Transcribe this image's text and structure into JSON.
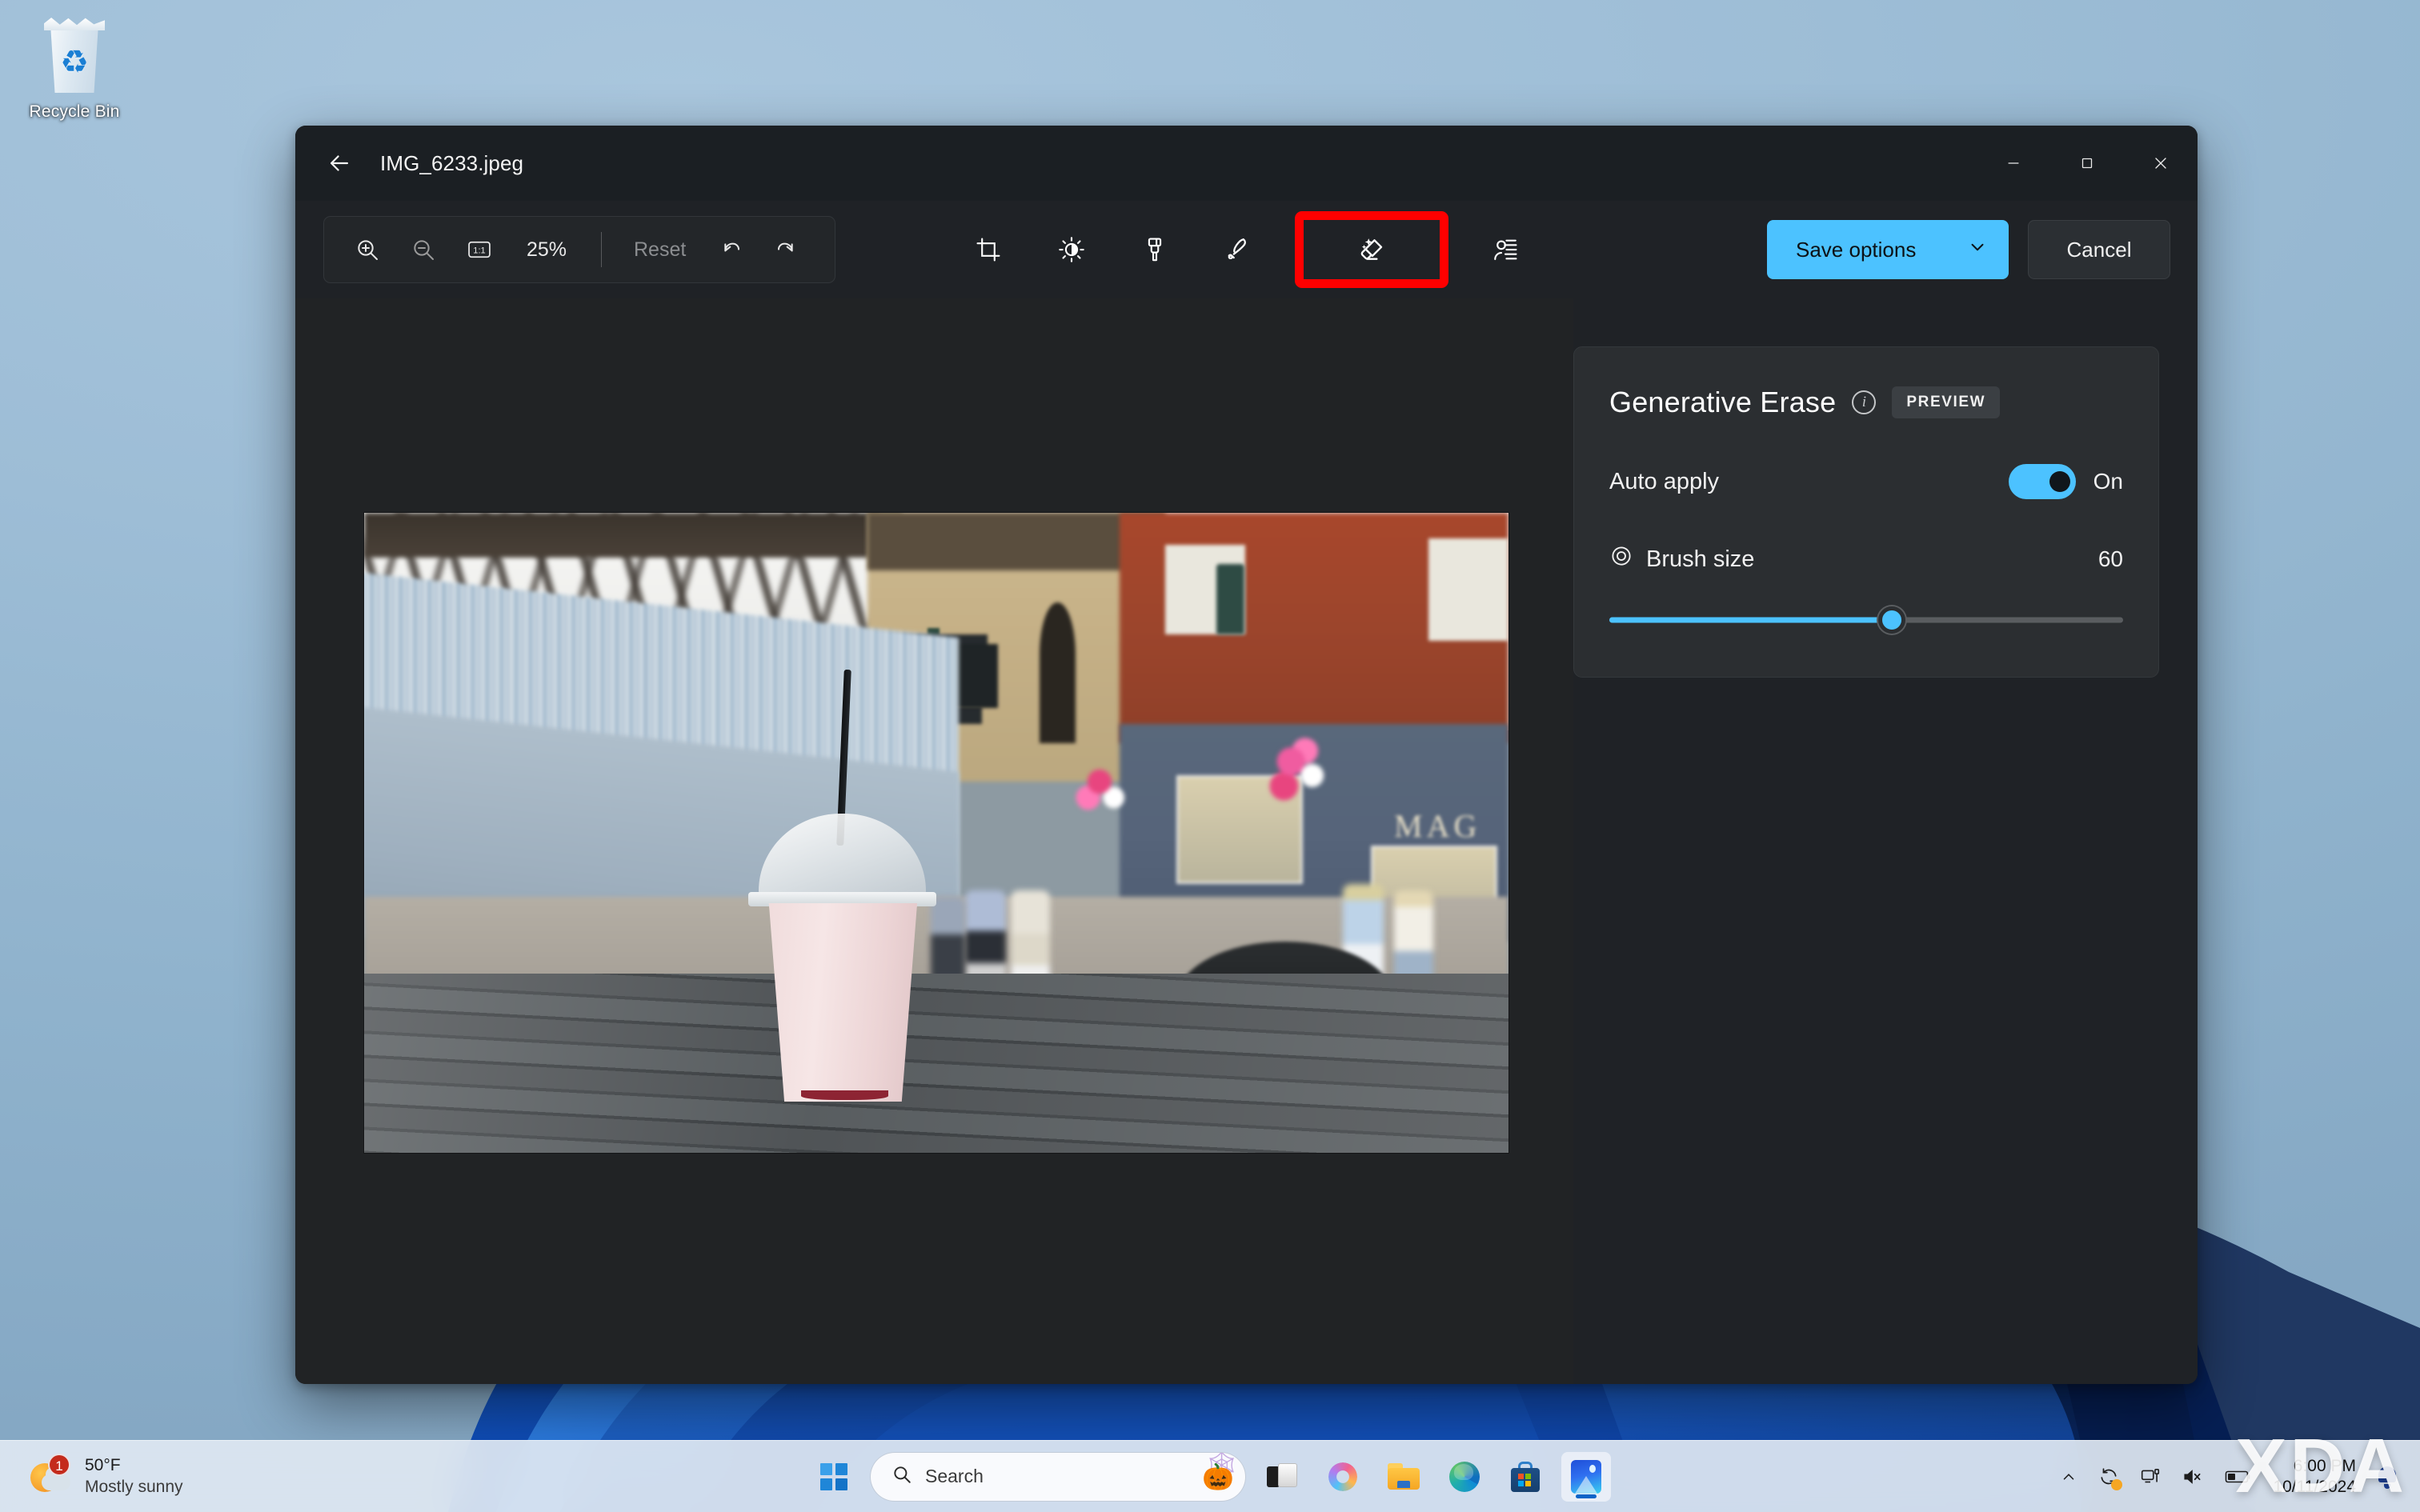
{
  "desktop": {
    "recycle_bin_label": "Recycle Bin"
  },
  "window": {
    "title": "IMG_6233.jpeg",
    "back_icon": "back-arrow-icon",
    "controls": {
      "minimize": "minimize-icon",
      "maximize": "maximize-icon",
      "close": "close-icon"
    }
  },
  "toolbar": {
    "zoom_in_icon": "zoom-in-icon",
    "zoom_out_icon": "zoom-out-icon",
    "actual_size_icon": "1:1",
    "zoom_level": "25%",
    "reset_label": "Reset",
    "undo_icon": "undo-icon",
    "redo_icon": "redo-icon",
    "edit_tools": [
      {
        "name": "crop",
        "icon": "crop-icon",
        "selected": false
      },
      {
        "name": "adjustment",
        "icon": "brightness-icon",
        "selected": false
      },
      {
        "name": "markup",
        "icon": "paintbrush-icon",
        "selected": false
      },
      {
        "name": "erase",
        "icon": "eraser-pen-icon",
        "selected": false
      },
      {
        "name": "generative-erase",
        "icon": "magic-erase-icon",
        "selected": true
      },
      {
        "name": "background-blur",
        "icon": "blur-icon",
        "selected": false
      }
    ],
    "save_options_label": "Save options",
    "save_options_chevron": "chevron-down-icon",
    "cancel_label": "Cancel"
  },
  "panel": {
    "title": "Generative Erase",
    "info_icon": "info-icon",
    "badge": "PREVIEW",
    "auto_apply_label": "Auto apply",
    "auto_apply_state": "On",
    "brush_size_label": "Brush size",
    "brush_size_icon": "brush-size-icon",
    "brush_size_value": "60",
    "brush_slider_percent": 55
  },
  "taskbar": {
    "weather": {
      "temperature": "50°F",
      "condition": "Mostly sunny",
      "badge_count": "1"
    },
    "start_icon": "windows-start-icon",
    "search_placeholder": "Search",
    "search_icon": "search-icon",
    "halloween_icon": "jack-o-lantern-icon",
    "pinned": [
      {
        "name": "task-view",
        "icon": "task-view-icon"
      },
      {
        "name": "copilot",
        "icon": "copilot-icon"
      },
      {
        "name": "file-explorer",
        "icon": "folder-icon"
      },
      {
        "name": "microsoft-edge",
        "icon": "edge-icon"
      },
      {
        "name": "microsoft-store",
        "icon": "store-icon"
      },
      {
        "name": "photos",
        "icon": "photos-icon",
        "active": true
      }
    ],
    "tray": {
      "overflow_icon": "chevron-up-icon",
      "update_icon": "windows-update-icon",
      "network_icon": "remote-desktop-icon",
      "volume_icon": "volume-muted-icon",
      "battery_icon": "battery-icon",
      "notification_icon": "bell-icon",
      "time": "6:00 PM",
      "date": "10/11/2024"
    }
  },
  "watermark": {
    "text": "XDA"
  },
  "colors": {
    "accent": "#4cc2ff",
    "annotation": "#ff0000",
    "window_bg": "#1f2226",
    "titlebar_bg": "#1b1f23",
    "panel_card": "#2b2e31",
    "desktop": "#8fb2cc"
  }
}
